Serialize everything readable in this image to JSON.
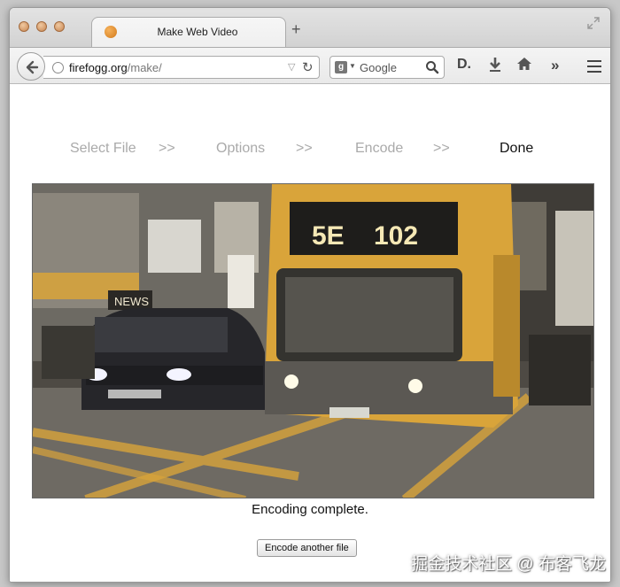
{
  "browser": {
    "tab_title": "Make Web Video",
    "new_tab_symbol": "+",
    "url_domain": "firefogg.org",
    "url_path": "/make/",
    "search_engine_letter": "g",
    "search_placeholder": "Google",
    "readability_label": "D.",
    "overflow_label": "»"
  },
  "steps": [
    {
      "label": "Select File"
    },
    {
      "label": "Options"
    },
    {
      "label": "Encode"
    },
    {
      "label": "Done"
    }
  ],
  "separator": ">>",
  "video": {
    "route_number": "102",
    "destination_text": "5E"
  },
  "status_text": "Encoding complete.",
  "encode_button_label": "Encode another file",
  "watermark": "掘金技术社区 @ 布客飞龙",
  "colors": {
    "bus_yellow": "#d9a43a",
    "step_inactive": "#aaaaaa",
    "step_active": "#111111"
  }
}
